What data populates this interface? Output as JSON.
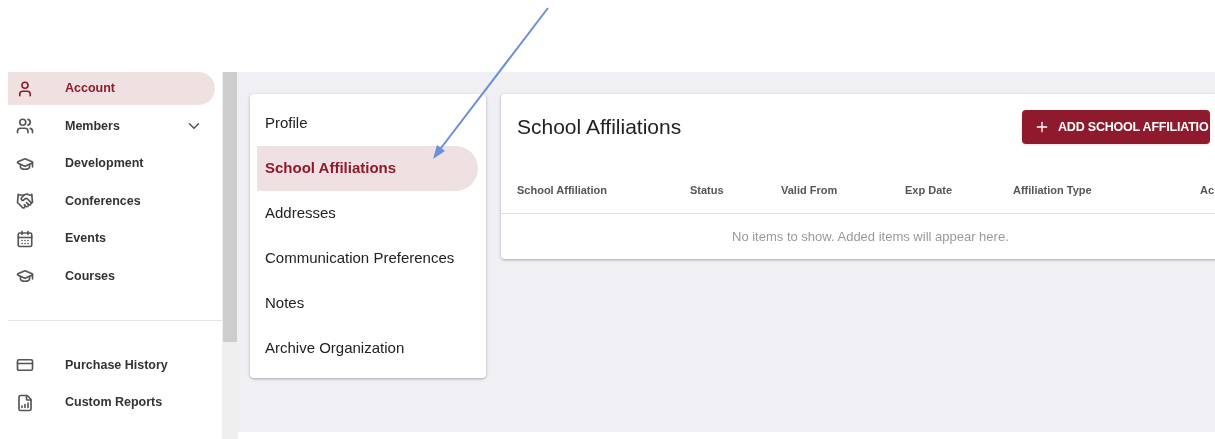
{
  "sidebar": {
    "items": [
      {
        "label": "Account",
        "selected": true
      },
      {
        "label": "Members",
        "selected": false,
        "expanded": false
      },
      {
        "label": "Development",
        "selected": false
      },
      {
        "label": "Conferences",
        "selected": false
      },
      {
        "label": "Events",
        "selected": false
      },
      {
        "label": "Courses",
        "selected": false
      }
    ],
    "lower_items": [
      {
        "label": "Purchase History",
        "selected": false
      },
      {
        "label": "Custom Reports",
        "selected": false
      }
    ]
  },
  "sub_nav": {
    "items": [
      {
        "label": "Profile",
        "selected": false
      },
      {
        "label": "School Affiliations",
        "selected": true
      },
      {
        "label": "Addresses",
        "selected": false
      },
      {
        "label": "Communication Preferences",
        "selected": false
      },
      {
        "label": "Notes",
        "selected": false
      },
      {
        "label": "Archive Organization",
        "selected": false
      }
    ]
  },
  "panel": {
    "title": "School Affiliations",
    "add_button": "ADD SCHOOL AFFILIATIO",
    "table": {
      "columns": [
        "School Affiliation",
        "Status",
        "Valid From",
        "Exp Date",
        "Affiliation Type",
        "Ac"
      ],
      "empty_message": "No items to show. Added items will appear here."
    }
  }
}
